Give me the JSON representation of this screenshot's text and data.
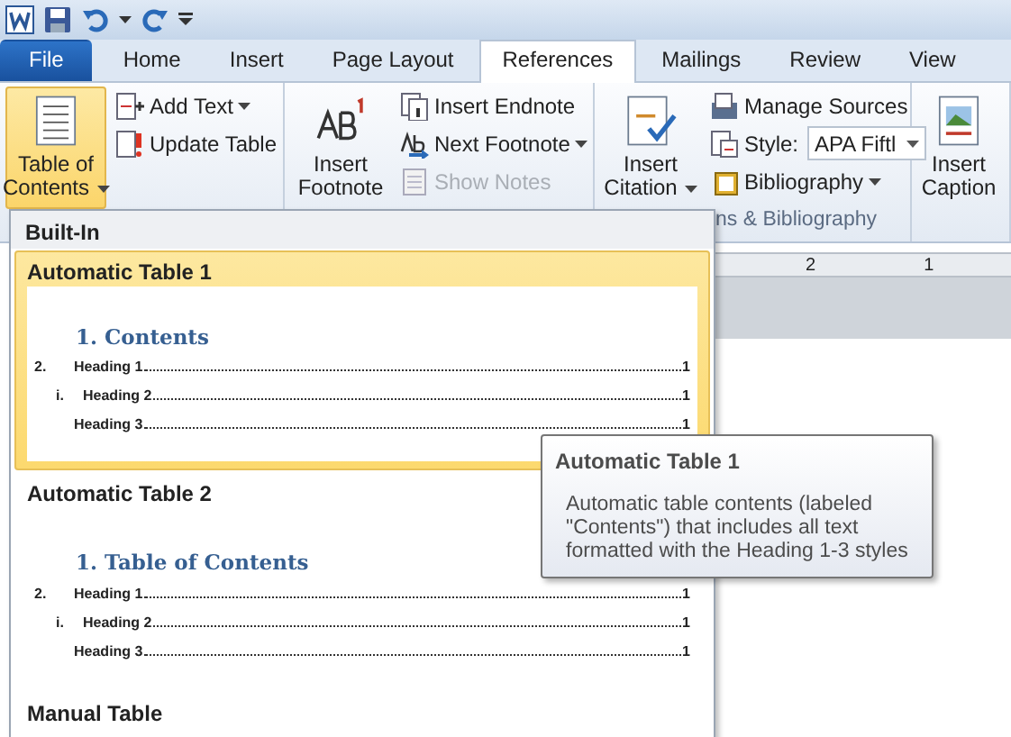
{
  "tabs": [
    {
      "label": "File",
      "kind": "file",
      "selected": false
    },
    {
      "label": "Home",
      "kind": "tab",
      "selected": false
    },
    {
      "label": "Insert",
      "kind": "tab",
      "selected": false
    },
    {
      "label": "Page Layout",
      "kind": "tab",
      "selected": false
    },
    {
      "label": "References",
      "kind": "tab",
      "selected": true
    },
    {
      "label": "Mailings",
      "kind": "tab",
      "selected": false
    },
    {
      "label": "Review",
      "kind": "tab",
      "selected": false
    },
    {
      "label": "View",
      "kind": "tab",
      "selected": false
    }
  ],
  "ribbon": {
    "groups": [
      {
        "large": {
          "label": "Table of Contents",
          "dropdown": true,
          "pressed": true
        },
        "small": [
          {
            "label": "Add Text",
            "dropdown": true,
            "disabled": false
          },
          {
            "label": "Update Table",
            "dropdown": false,
            "disabled": false
          }
        ]
      },
      {
        "large": {
          "label": "Insert Footnote",
          "dropdown": false,
          "pressed": false
        },
        "small": [
          {
            "label": "Insert Endnote",
            "dropdown": false,
            "disabled": false
          },
          {
            "label": "Next Footnote",
            "dropdown": true,
            "disabled": false
          },
          {
            "label": "Show Notes",
            "dropdown": false,
            "disabled": true
          }
        ]
      },
      {
        "label": "ns & Bibliography",
        "large": {
          "label": "Insert Citation",
          "dropdown": true,
          "pressed": false
        },
        "small": [
          {
            "label": "Manage Sources",
            "dropdown": false,
            "disabled": false
          },
          {
            "label": "Style:",
            "select": "APA Fiftl"
          },
          {
            "label": "Bibliography",
            "dropdown": true,
            "disabled": false
          }
        ]
      },
      {
        "large": {
          "label": "Insert Caption",
          "dropdown": false,
          "pressed": false
        }
      }
    ]
  },
  "ruler": {
    "numbers": [
      "2",
      "1"
    ]
  },
  "gallery": {
    "section": "Built-In",
    "items": [
      {
        "title": "Automatic Table 1",
        "selected": true,
        "heading": "1.  Contents",
        "entries": [
          {
            "kind": "h1",
            "number": "2.",
            "text": "Heading 1",
            "page": "1"
          },
          {
            "kind": "h2",
            "number": "i.",
            "text": "Heading 2",
            "page": "1"
          },
          {
            "kind": "h3",
            "text": "Heading 3",
            "page": "1"
          }
        ]
      },
      {
        "title": "Automatic Table 2",
        "selected": false,
        "heading": "1.  Table of Contents",
        "entries": [
          {
            "kind": "h1",
            "number": "2.",
            "text": "Heading 1",
            "page": "1"
          },
          {
            "kind": "h2",
            "number": "i.",
            "text": "Heading 2",
            "page": "1"
          },
          {
            "kind": "h3",
            "text": "Heading 3",
            "page": "1"
          }
        ]
      },
      {
        "title": "Manual Table",
        "selected": false
      }
    ]
  },
  "tooltip": {
    "title": "Automatic Table 1",
    "body": "Automatic table contents (labeled \"Contents\") that includes all text formatted with the Heading 1-3 styles"
  }
}
